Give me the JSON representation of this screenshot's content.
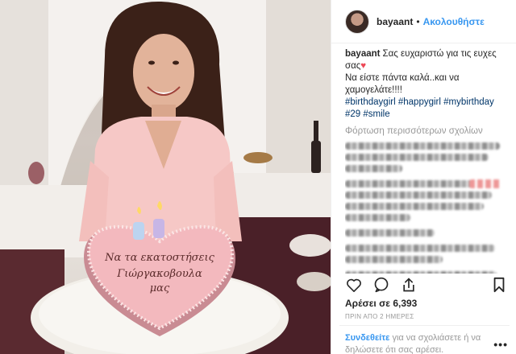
{
  "post": {
    "username": "bayaant",
    "follow_label": "Ακολουθήστε",
    "dot": "•",
    "caption": {
      "line1": "Σας ευχαριστώ για τις ευχες σας",
      "heart": "♥",
      "line2": "Να είστε πάντα καλά..και να χαμογελάτε!!!!",
      "hashtags": [
        "#birthdaygirl",
        "#happygirl",
        "#mybirthday",
        "#29",
        "#smile"
      ]
    },
    "load_more": "Φόρτωση περισσότερων σχολίων",
    "likes": "Αρέσει σε 6,393",
    "time": "ΠΡΙΝ ΑΠΟ 2 ΗΜΕΡΕΣ",
    "login": {
      "link": "Συνδεθείτε",
      "text": "για να σχολιάσετε ή να δηλώσετε ότι σας αρέσει."
    },
    "more": "•••"
  },
  "photo": {
    "cake_text_line1": "Να τα εκατοστήσεις",
    "cake_text_line2": "Γιώργακοβουλα",
    "cake_text_line3": "μας",
    "candles": "29"
  },
  "colors": {
    "accent": "#3897f0",
    "hashtag": "#003569",
    "heart": "#ed4956",
    "cake": "#f3b9be"
  },
  "icons": {
    "like": "heart-outline-icon",
    "comment": "comment-bubble-icon",
    "share": "share-arrow-icon",
    "save": "bookmark-icon"
  }
}
